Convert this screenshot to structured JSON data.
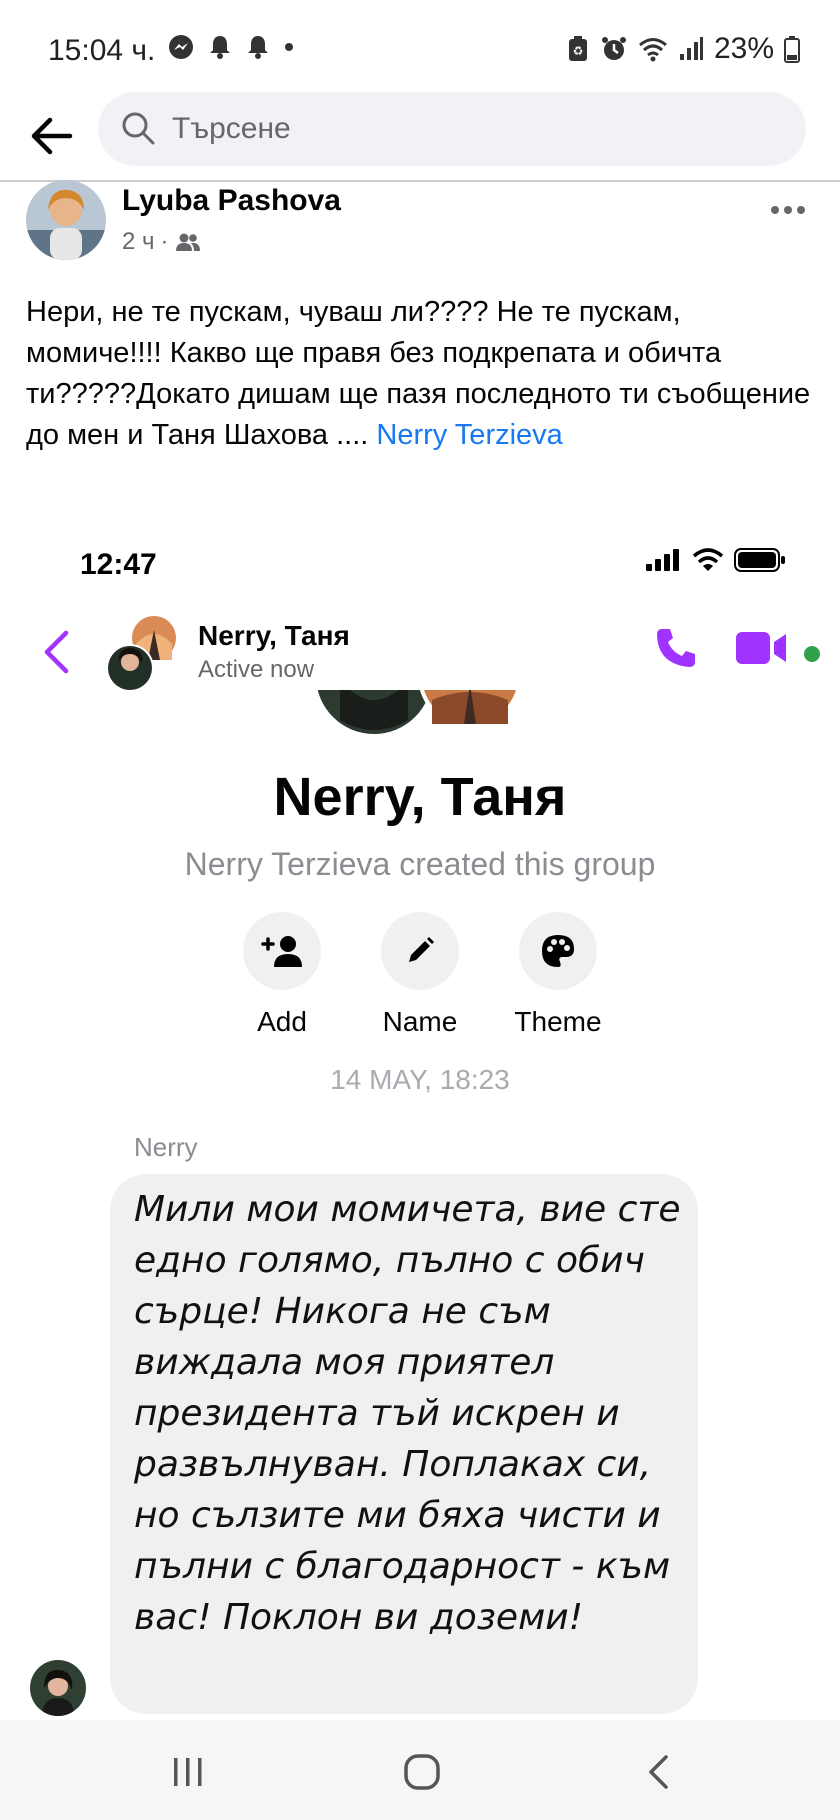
{
  "status_bar": {
    "time": "15:04 ч.",
    "battery": "23%"
  },
  "search": {
    "placeholder": "Търсене"
  },
  "post": {
    "author": "Lyuba Pashova",
    "time": "2 ч",
    "separator": "·",
    "text": "Нери, не те пускам, чуваш ли???? Не те пускам, момиче!!!! Какво ще правя без  подкрепата и обичта ти?????Докато дишам ще пазя последното ти съобщение до мен и Таня Шахова ....",
    "link_text": "Nerry Terzieva"
  },
  "screenshot": {
    "time": "12:47",
    "chat_name": "Nerry, Таня",
    "chat_status": "Active now",
    "group_title": "Nerry, Таня",
    "created_text": "Nerry Terzieva created this group",
    "actions": [
      {
        "label": "Add",
        "icon": "add-person-icon"
      },
      {
        "label": "Name",
        "icon": "pencil-icon"
      },
      {
        "label": "Theme",
        "icon": "palette-icon"
      }
    ],
    "date_label": "14 MAY, 18:23",
    "sender": "Nerry",
    "message": "Мили мои момичета, вие сте едно голямо, пълно с обич сърце! Никога не съм виждала моя приятел президента тъй искрен и развълнуван. Поплаках си, но сълзите ми бяха чисти и пълни с благодарност - към вас! Поклон ви доземи!"
  },
  "colors": {
    "messenger_purple": "#a033ff",
    "facebook_blue": "#1877f2",
    "online_green": "#31a24c"
  }
}
